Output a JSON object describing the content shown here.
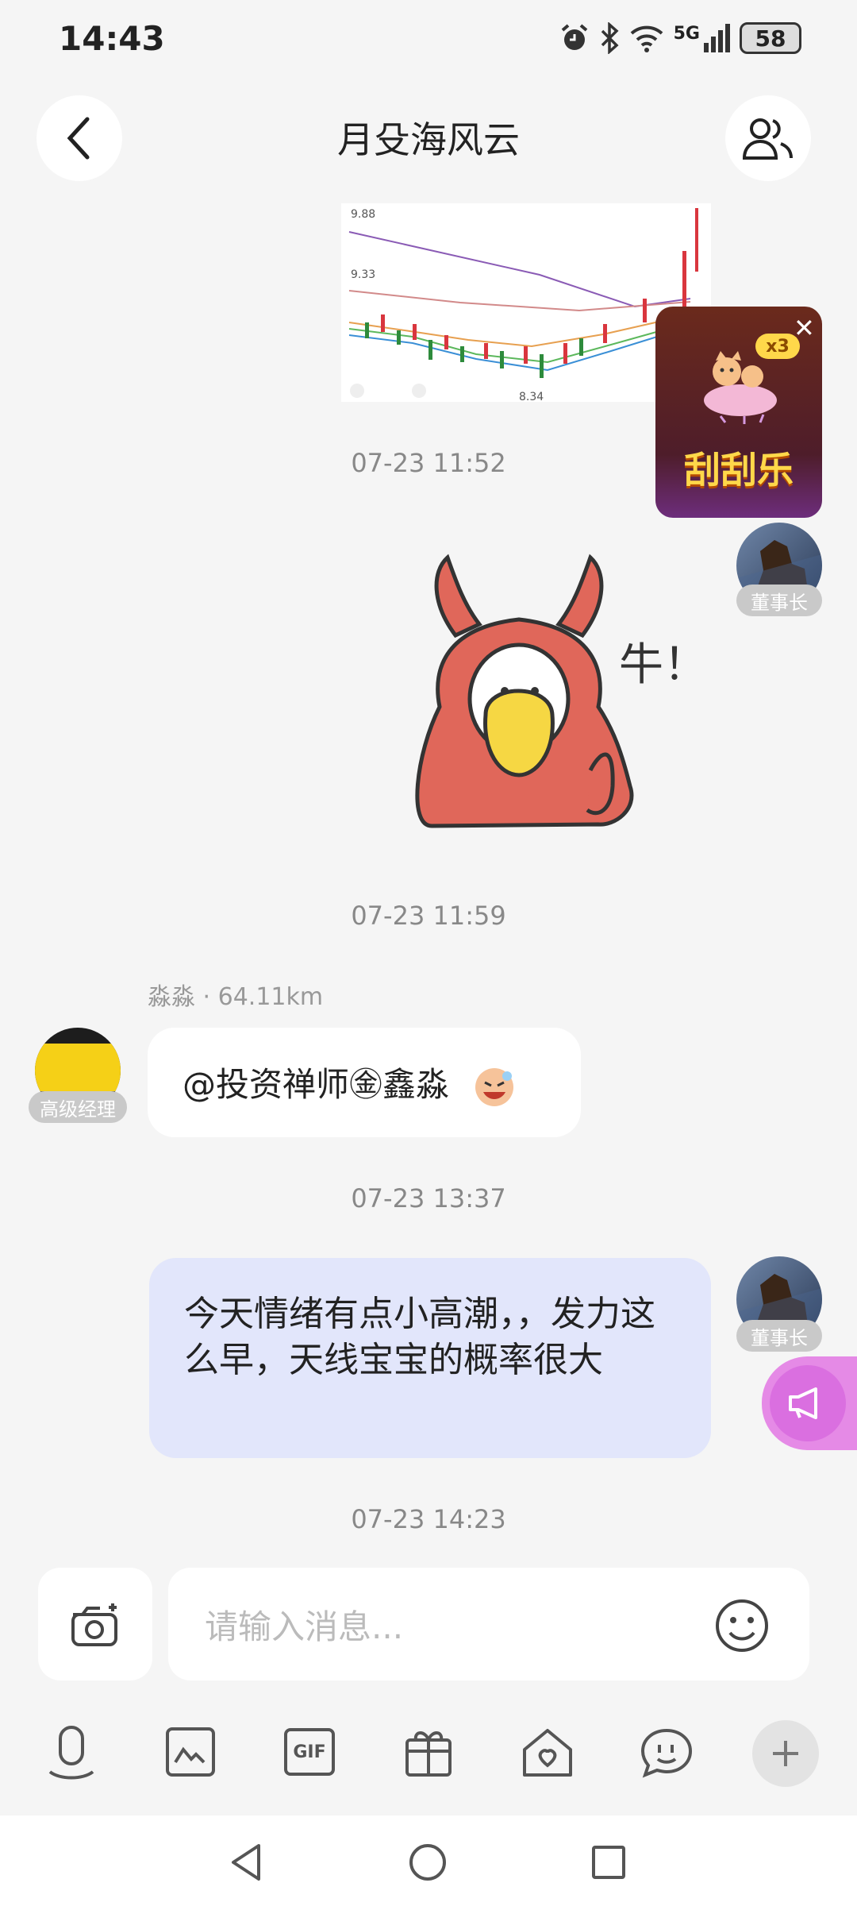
{
  "status": {
    "time": "14:43",
    "network": "5G",
    "battery": "58"
  },
  "header": {
    "title": "月殳海风云"
  },
  "messages": {
    "ts1": "07-23 11:52",
    "chairman_tag_1": "董事长",
    "sticker_text": "牛！",
    "ts2": "07-23 11:59",
    "sender_name": "淼淼",
    "sender_distance": "· 64.11km",
    "sender_tag": "高级经理",
    "left_bubble": "@投资禅师㊎鑫淼",
    "ts3": "07-23 13:37",
    "right_bubble": "今天情绪有点小高潮，，发力这么早，天线宝宝的概率很大",
    "chairman_tag_2": "董事长",
    "ts4": "07-23 14:23"
  },
  "stock_chart": {
    "price_top": "9.88",
    "price_mid": "9.33",
    "price_low": "8.34"
  },
  "promo": {
    "badge": "x3",
    "label": "刮刮乐"
  },
  "input": {
    "placeholder": "请输入消息..."
  },
  "toolbar": {
    "gif_label": "GIF"
  },
  "colors": {
    "accent": "#e58ae6",
    "bubble_self": "#e2e6fb",
    "promo_bg": "#5a1f1a"
  }
}
